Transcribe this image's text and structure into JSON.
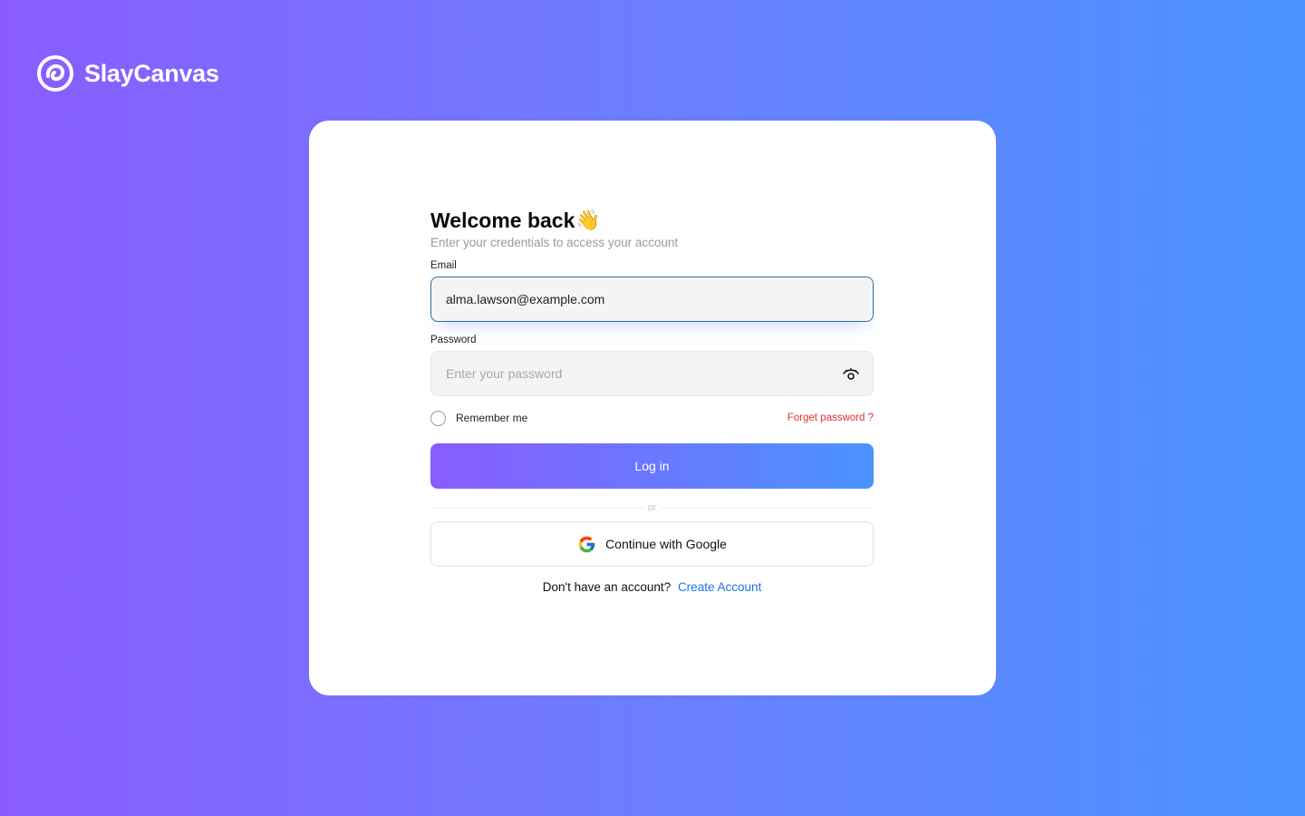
{
  "brand": {
    "name": "SlayCanvas",
    "icon": "slaycanvas-logo"
  },
  "login": {
    "title": "Welcome back",
    "title_emoji": "👋",
    "subtitle": "Enter your credentials to access your account",
    "email": {
      "label": "Email",
      "value": "alma.lawson@example.com"
    },
    "password": {
      "label": "Password",
      "placeholder": "Enter your password",
      "icon": "eye-icon"
    },
    "remember_label": "Remember me",
    "forgot_label": "Forget password ?",
    "login_button": "Log in",
    "divider": "or",
    "google_button": "Continue with Google",
    "signup_prompt": "Don't have an account?",
    "signup_link": "Create Account"
  },
  "colors": {
    "gradient_start": "#8a5cff",
    "gradient_end": "#4a93ff",
    "link": "#1a73e8",
    "forgot": "#e0302b"
  }
}
